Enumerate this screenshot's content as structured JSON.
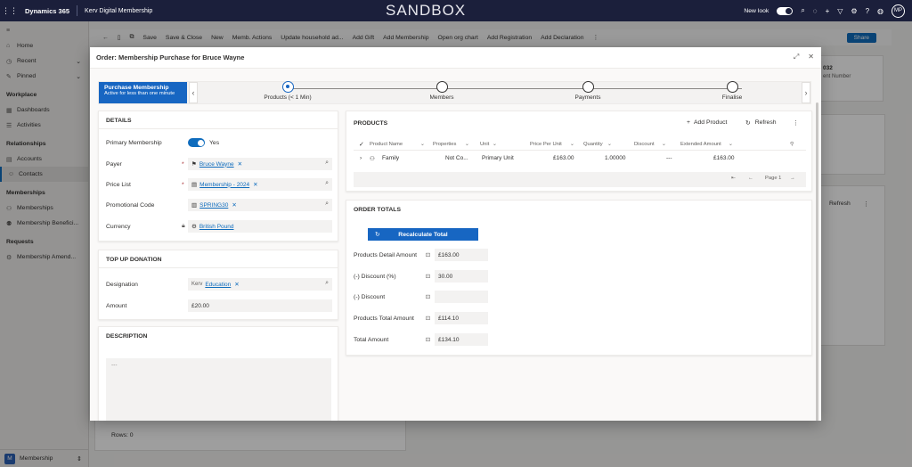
{
  "topbar": {
    "product": "Dynamics 365",
    "app_name": "Kerv Digital Membership",
    "environment": "SANDBOX",
    "new_look_label": "New look",
    "user_initials": "MP"
  },
  "sidebar": {
    "items_top": [
      {
        "label": "Home",
        "icon": "home-icon"
      },
      {
        "label": "Recent",
        "icon": "clock-icon"
      },
      {
        "label": "Pinned",
        "icon": "pin-icon"
      }
    ],
    "groups": [
      {
        "title": "Workplace",
        "items": [
          "Dashboards",
          "Activities"
        ]
      },
      {
        "title": "Relationships",
        "items": [
          "Accounts",
          "Contacts"
        ]
      },
      {
        "title": "Memberships",
        "items": [
          "Memberships",
          "Membership Benefici..."
        ]
      },
      {
        "title": "Requests",
        "items": [
          "Membership Amend..."
        ]
      }
    ],
    "active_item": "Contacts",
    "area_switcher": {
      "badge": "M",
      "label": "Membership"
    }
  },
  "commandbar": {
    "items": [
      "Save",
      "Save & Close",
      "New",
      "Memb. Actions",
      "Update household ad...",
      "Add Gift",
      "Add Membership",
      "Open org chart",
      "Add Registration",
      "Add Declaration"
    ],
    "share": "Share"
  },
  "background": {
    "rows_label": "Rows: 0",
    "refresh": "Refresh",
    "partial_number": "032",
    "partial_label": "ent Number"
  },
  "dialog": {
    "title": "Order: Membership Purchase for Bruce Wayne",
    "bpf": {
      "active_stage_name": "Purchase Membership",
      "active_stage_sub": "Active for less than one minute",
      "stages": [
        "Products  (< 1 Min)",
        "Members",
        "Payments",
        "Finalise"
      ]
    },
    "details": {
      "title": "DETAILS",
      "primary_membership_label": "Primary Membership",
      "primary_membership_value": "Yes",
      "payer_label": "Payer",
      "payer_value": "Bruce Wayne",
      "price_list_label": "Price List",
      "price_list_value": "Membership - 2024",
      "promo_label": "Promotional Code",
      "promo_value": "SPRING30",
      "currency_label": "Currency",
      "currency_value": "British Pound"
    },
    "donation": {
      "title": "TOP UP DONATION",
      "designation_label": "Designation",
      "designation_value": "Education",
      "designation_chip": "Kerv",
      "amount_label": "Amount",
      "amount_value": "£20.00"
    },
    "description": {
      "title": "DESCRIPTION",
      "placeholder": "---"
    },
    "products": {
      "title": "PRODUCTS",
      "add_label": "Add Product",
      "refresh_label": "Refresh",
      "columns": [
        "Product Name",
        "Properties",
        "Unit",
        "Price Per Unit",
        "Quantity",
        "Discount",
        "Extended Amount"
      ],
      "row": {
        "name": "Family",
        "properties": "Not Co...",
        "unit": "Primary Unit",
        "price": "£163.00",
        "quantity": "1.00000",
        "discount": "---",
        "extended": "£163.00"
      },
      "page_label": "Page 1"
    },
    "totals": {
      "title": "ORDER TOTALS",
      "recalc_label": "Recalculate Total",
      "rows": [
        {
          "label": "Products Detail Amount",
          "value": "£163.00"
        },
        {
          "label": "(-) Discount (%)",
          "value": "30.00"
        },
        {
          "label": "(-) Discount",
          "value": ""
        },
        {
          "label": "Products Total Amount",
          "value": "£114.10"
        },
        {
          "label": "Total Amount",
          "value": "£134.10"
        }
      ]
    }
  }
}
